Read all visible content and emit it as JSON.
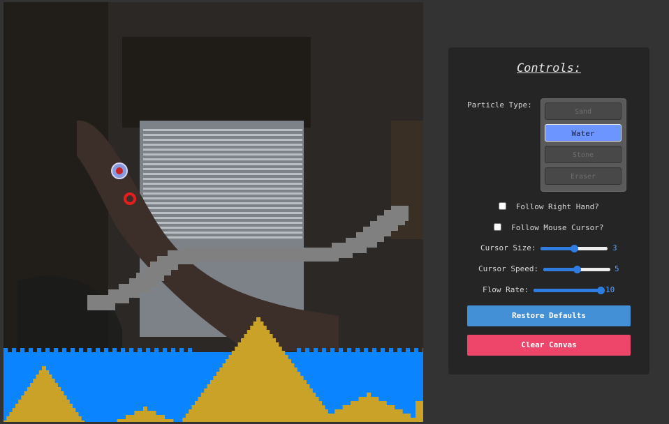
{
  "controls": {
    "title": "Controls:",
    "particle_type_label": "Particle Type:",
    "particle_types": [
      "Sand",
      "Water",
      "Stone",
      "Eraser"
    ],
    "selected_type": "Water",
    "follow_right_hand_label": "Follow Right Hand?",
    "follow_right_hand_checked": false,
    "follow_mouse_label": "Follow Mouse Cursor?",
    "follow_mouse_checked": false,
    "cursor_size": {
      "label": "Cursor Size:",
      "value": "3",
      "fraction": 0.5
    },
    "cursor_speed": {
      "label": "Cursor Speed:",
      "value": "5",
      "fraction": 0.5
    },
    "flow_rate": {
      "label": "Flow Rate:",
      "value": "10",
      "fraction": 1.0
    },
    "restore_label": "Restore Defaults",
    "clear_label": "Clear Canvas"
  },
  "colors": {
    "sand": "#c9a227",
    "water": "#0a84ff",
    "stone": "#808080",
    "accent": "#2f7de1",
    "restore": "#4390d7",
    "clear": "#ee466b"
  }
}
